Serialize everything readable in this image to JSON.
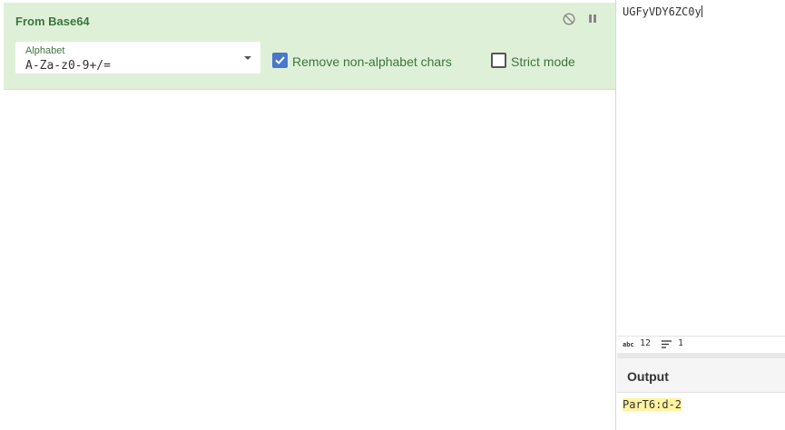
{
  "operation": {
    "title": "From Base64",
    "alphabet_label": "Alphabet",
    "alphabet_value": "A-Za-z0-9+/=",
    "remove_nonalpha": {
      "label": "Remove non-alphabet chars",
      "checked": true
    },
    "strict_mode": {
      "label": "Strict mode",
      "checked": false
    },
    "disable_icon": "disable-icon",
    "pause_icon": "pause-icon"
  },
  "input": {
    "text": "UGFyVDY6ZC0y",
    "stats": {
      "length_label": "abc",
      "length": "12",
      "lines": "1"
    }
  },
  "output": {
    "title": "Output",
    "text": "ParT6:d-2"
  },
  "colors": {
    "op_bg": "#dff0d8",
    "op_text": "#3c763d",
    "checkbox_checked": "#4a78c9",
    "highlight": "#fff3a0"
  }
}
